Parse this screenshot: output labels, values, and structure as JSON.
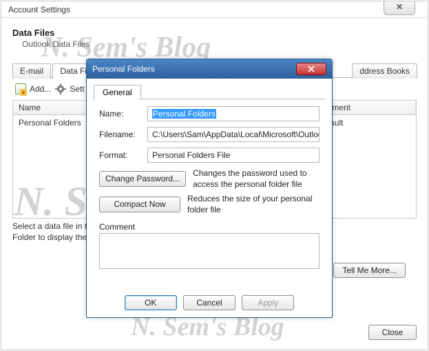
{
  "main": {
    "title": "Account Settings",
    "section_title": "Data Files",
    "section_sub": "Outlook Data Files",
    "tabs": [
      "E-mail",
      "Data Files",
      "",
      "",
      "",
      "",
      "ddress Books"
    ],
    "active_tab_index": 1,
    "toolbar": {
      "add": "Add...",
      "settings": "Sett"
    },
    "columns": {
      "name": "Name",
      "comment": "Comment"
    },
    "rows": [
      {
        "name": "Personal Folders",
        "comment": "Default"
      }
    ],
    "hint": "Select a data file in the list, then click Settings for more details or click Open Folder to display the folder that contains the data file.",
    "tell_more": "Tell Me More...",
    "close": "Close"
  },
  "dialog": {
    "title": "Personal Folders",
    "tab": "General",
    "labels": {
      "name": "Name:",
      "filename": "Filename:",
      "format": "Format:"
    },
    "name_value": "Personal Folders",
    "filename_value": "C:\\Users\\Sam\\AppData\\Local\\Microsoft\\Outlook\\Outlo",
    "format_value": "Personal Folders File",
    "change_pw": "Change Password...",
    "change_pw_help": "Changes the password used to access the personal folder file",
    "compact": "Compact Now",
    "compact_help": "Reduces the size of your personal folder file",
    "comment_label": "Comment",
    "ok": "OK",
    "cancel": "Cancel",
    "apply": "Apply"
  },
  "watermark": "N. Sem's Blog"
}
